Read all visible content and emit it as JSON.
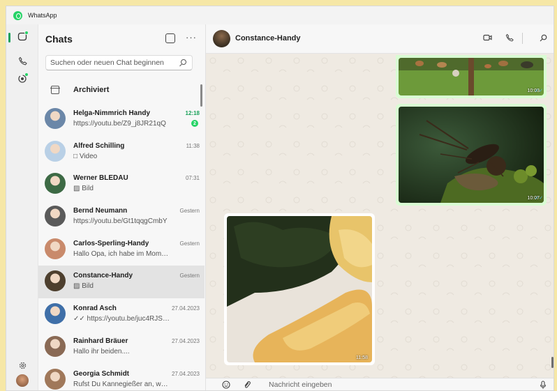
{
  "window": {
    "title": "WhatsApp"
  },
  "rail": {
    "icons": [
      "chats-icon",
      "calls-icon",
      "status-icon",
      "settings-icon",
      "profile-avatar"
    ]
  },
  "panel": {
    "title": "Chats",
    "search_placeholder": "Suchen oder neuen Chat beginnen",
    "archived_label": "Archiviert"
  },
  "chats": [
    {
      "name": "Helga-Nimmrich Handy",
      "preview": "https://youtu.be/Z9_j8JR21qQ",
      "time": "12:18",
      "unread": "2",
      "time_color": "#1aa15a",
      "avatar_color": "#6b87a8"
    },
    {
      "name": "Alfred Schilling",
      "preview": "□ Video",
      "time": "11:38",
      "avatar_color": "#b9d0e6"
    },
    {
      "name": "Werner BLEDAU",
      "preview": "▨ Bild",
      "time": "07:31",
      "avatar_color": "#3d6a45"
    },
    {
      "name": "Bernd Neumann",
      "preview": "https://youtu.be/Gt1tqqgCmbY",
      "time": "Gestern",
      "avatar_color": "#5a5a5a"
    },
    {
      "name": "Carlos-Sperling-Handy",
      "preview": "Hallo Opa, ich habe im Moment no...",
      "time": "Gestern",
      "avatar_color": "#c98a6b"
    },
    {
      "name": "Constance-Handy",
      "preview": "▨ Bild",
      "time": "Gestern",
      "avatar_color": "#4d3f2e",
      "selected": true
    },
    {
      "name": "Konrad Asch",
      "preview": "✓✓ https://youtu.be/juc4RJSE7Yw",
      "time": "27.04.2023",
      "avatar_color": "#3f6fa8"
    },
    {
      "name": "Rainhard Bräuer",
      "preview": "Hallo ihr beiden....",
      "time": "27.04.2023",
      "avatar_color": "#8a6a55"
    },
    {
      "name": "Georgia Schmidt",
      "preview": "Rufst Du Kannegießer an, wegen R...",
      "time": "27.04.2023",
      "avatar_color": "#a0785a"
    }
  ],
  "conversation": {
    "contact": "Constance-Handy",
    "messages": [
      {
        "type": "image",
        "direction": "out",
        "time": "10:03",
        "subject": "chickens-on-grass"
      },
      {
        "type": "image",
        "direction": "out",
        "time": "10:07",
        "subject": "beetle-on-moss"
      },
      {
        "type": "image",
        "direction": "in",
        "time": "11:58",
        "subject": "spinach-and-omelette"
      }
    ],
    "composer_placeholder": "Nachricht eingeben"
  }
}
